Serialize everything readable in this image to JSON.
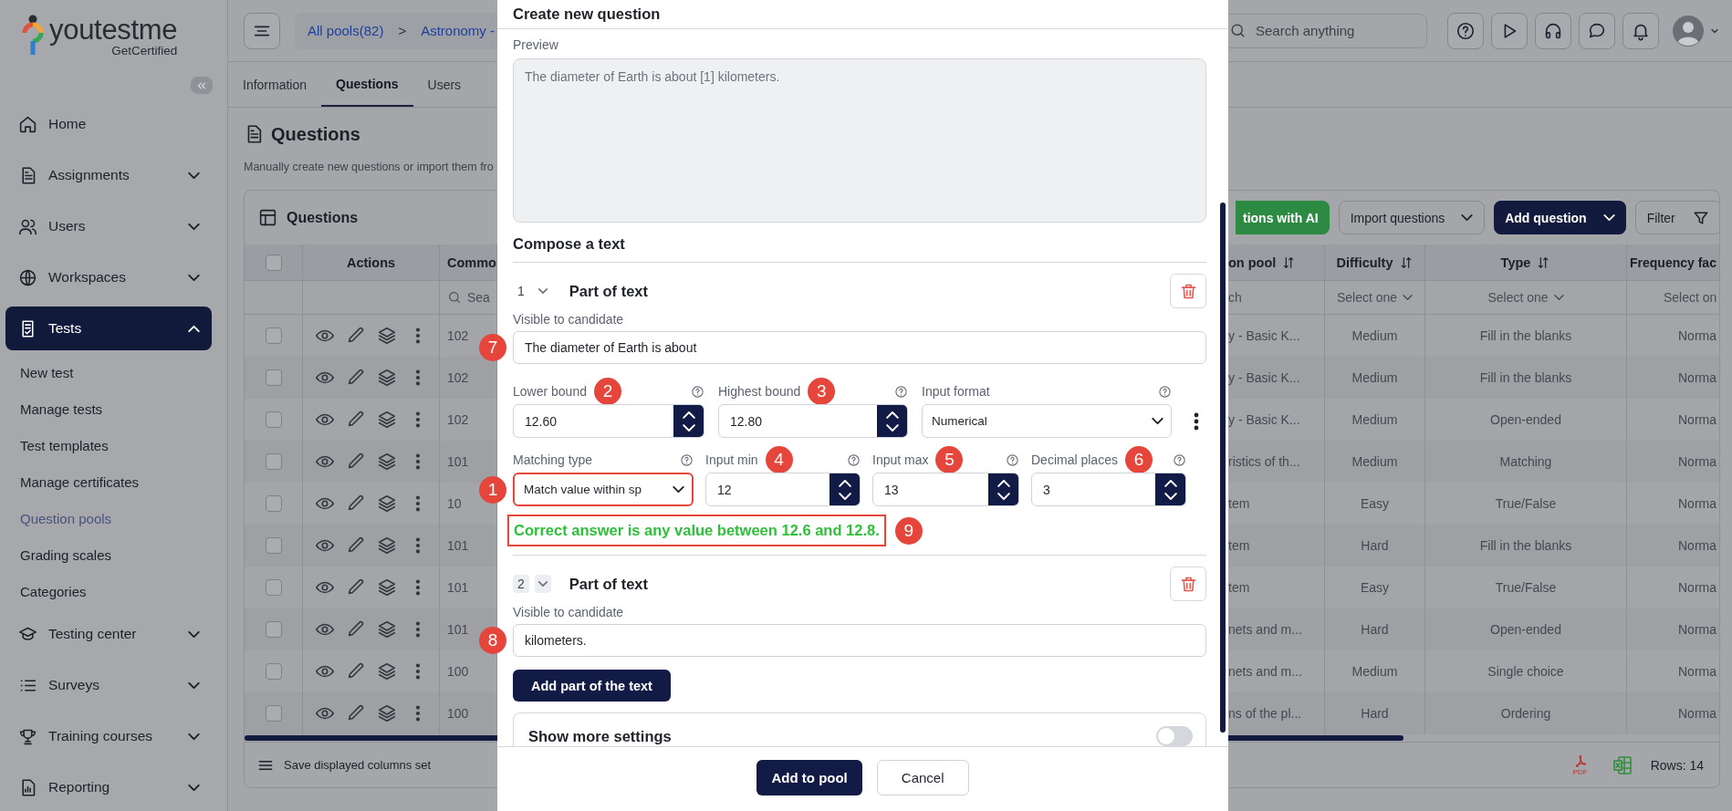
{
  "sidebar": {
    "logo": {
      "brand": "youtestme",
      "tagline": "GetCertified"
    },
    "items": [
      {
        "label": "Home",
        "kind": "link",
        "selected": false
      },
      {
        "label": "Assignments",
        "kind": "group",
        "selected": false,
        "expanded": false
      },
      {
        "label": "Users",
        "kind": "group",
        "selected": false,
        "expanded": false
      },
      {
        "label": "Workspaces",
        "kind": "group",
        "selected": false,
        "expanded": false
      },
      {
        "label": "Tests",
        "kind": "group",
        "selected": true,
        "expanded": true,
        "children": [
          {
            "label": "New test",
            "selected": false
          },
          {
            "label": "Manage tests",
            "selected": false
          },
          {
            "label": "Test templates",
            "selected": false
          },
          {
            "label": "Manage certificates",
            "selected": false
          },
          {
            "label": "Question pools",
            "selected": true
          },
          {
            "label": "Grading scales",
            "selected": false
          },
          {
            "label": "Categories",
            "selected": false
          }
        ]
      },
      {
        "label": "Testing center",
        "kind": "group",
        "selected": false,
        "expanded": false
      },
      {
        "label": "Surveys",
        "kind": "group",
        "selected": false,
        "expanded": false
      },
      {
        "label": "Training courses",
        "kind": "group",
        "selected": false,
        "expanded": false
      },
      {
        "label": "Reporting",
        "kind": "group",
        "selected": false,
        "expanded": false
      }
    ]
  },
  "topbar": {
    "breadcrumb": [
      {
        "label": "All pools(82)"
      },
      {
        "label": "Astronomy -"
      }
    ],
    "separator": ">",
    "search": {
      "placeholder": "Search anything"
    }
  },
  "tabs": [
    {
      "label": "Information",
      "selected": false
    },
    {
      "label": "Questions",
      "selected": true
    },
    {
      "label": "Users",
      "selected": false
    }
  ],
  "page": {
    "title": "Questions",
    "subtitle": "Manually create new questions or import them fro"
  },
  "questions_table": {
    "title": "Questions",
    "buttons": [
      {
        "label": "tions with AI",
        "kind": "ai"
      },
      {
        "label": "Import questions",
        "kind": "dropdown"
      },
      {
        "label": "Add question",
        "kind": "primary"
      },
      {
        "label": "Filter",
        "kind": "filter"
      }
    ],
    "header_checked": false,
    "actions_header": "Actions",
    "columns": [
      {
        "label": "Commo",
        "filter": {
          "kind": "search",
          "text": "Sea"
        }
      },
      {
        "label": "on pool",
        "sortable": true,
        "filter": {
          "kind": "text",
          "text": "ch"
        }
      },
      {
        "label": "Difficulty",
        "sortable": true,
        "filter": {
          "kind": "select",
          "text": "Select one"
        }
      },
      {
        "label": "Type",
        "sortable": true,
        "filter": {
          "kind": "select",
          "text": "Select one"
        }
      },
      {
        "label": "Frequency fac",
        "filter": {
          "kind": "text",
          "text": "Select on"
        }
      }
    ],
    "rows": [
      {
        "checked": false,
        "cells": [
          "102",
          "y - Basic K...",
          "Medium",
          "Fill in the blanks",
          "Norma"
        ]
      },
      {
        "checked": false,
        "cells": [
          "102",
          "y - Basic K...",
          "Medium",
          "Fill in the blanks",
          "Norma"
        ]
      },
      {
        "checked": false,
        "cells": [
          "102",
          "y - Basic K...",
          "Medium",
          "Open-ended",
          "Norma"
        ]
      },
      {
        "checked": false,
        "cells": [
          "101",
          "ristics of th...",
          "Medium",
          "Matching",
          "Norma"
        ]
      },
      {
        "checked": false,
        "cells": [
          "10",
          "tem",
          "Easy",
          "True/False",
          "Norma"
        ]
      },
      {
        "checked": false,
        "cells": [
          "101",
          "tem",
          "Hard",
          "Fill in the blanks",
          "Norma"
        ]
      },
      {
        "checked": false,
        "cells": [
          "101",
          "tem",
          "Easy",
          "True/False",
          "Norma"
        ]
      },
      {
        "checked": false,
        "cells": [
          "101",
          "nets and m...",
          "Hard",
          "Open-ended",
          "Norma"
        ]
      },
      {
        "checked": false,
        "cells": [
          "100",
          "nets and m...",
          "Medium",
          "Single choice",
          "Norma"
        ]
      },
      {
        "checked": false,
        "cells": [
          "100",
          "ns of the pl...",
          "Hard",
          "Ordering",
          "Norma"
        ]
      }
    ],
    "footer": {
      "save_label": "Save displayed columns set",
      "pdf_label": "PDF",
      "rows_label": "Rows: 14"
    }
  },
  "modal": {
    "title": "Create new question",
    "preview": {
      "label": "Preview",
      "text": "The diameter of Earth is about [1] kilometers."
    },
    "compose_title": "Compose a text",
    "parts": [
      {
        "number": "1",
        "title": "Part of text",
        "hovered": false,
        "kind": "blank",
        "visible_label": "Visible to candidate",
        "text": "The diameter of Earth is about",
        "badge": "7",
        "rows": [
          {
            "more_menu": true,
            "fields": [
              {
                "kind": "number",
                "label": "Lower bound",
                "value": "12.60",
                "badge": "2",
                "highlighted": false
              },
              {
                "kind": "number",
                "label": "Highest bound",
                "value": "12.80",
                "badge": "3",
                "highlighted": false
              },
              {
                "kind": "select",
                "label": "Input format",
                "value": "Numerical",
                "highlighted": false
              }
            ]
          },
          {
            "more_menu": false,
            "fields": [
              {
                "kind": "select",
                "label": "Matching type",
                "value": "Match value within sp",
                "badge": "1",
                "highlighted": true
              },
              {
                "kind": "number",
                "label": "Input min",
                "value": "12",
                "badge": "4",
                "highlighted": false
              },
              {
                "kind": "number",
                "label": "Input max",
                "value": "13",
                "badge": "5",
                "highlighted": false
              },
              {
                "kind": "number",
                "label": "Decimal places",
                "value": "3",
                "badge": "6",
                "highlighted": false
              }
            ]
          }
        ],
        "message": {
          "text": "Correct answer is any value between 12.6 and 12.8.",
          "badge": "9",
          "highlighted": true
        }
      },
      {
        "number": "2",
        "title": "Part of text",
        "hovered": true,
        "kind": "text",
        "visible_label": "Visible to candidate",
        "text": "kilometers.",
        "badge": "8"
      }
    ],
    "add_part_button": "Add part of the text",
    "more_settings": {
      "label": "Show more settings",
      "on": false
    },
    "buttons": [
      {
        "label": "Add to pool",
        "kind": "primary"
      },
      {
        "label": "Cancel",
        "kind": "secondary"
      }
    ]
  }
}
